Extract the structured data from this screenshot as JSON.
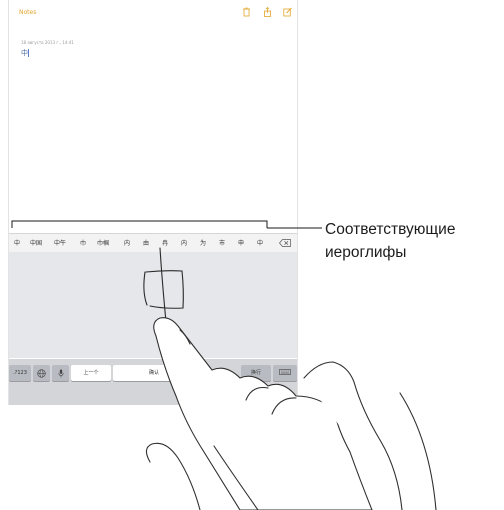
{
  "notes": {
    "title": "Notes",
    "date": "18 августа 2013 г., 14:41",
    "text": "中"
  },
  "candidates": [
    "中",
    "中国",
    "中午",
    "巾",
    "巾帼",
    "内",
    "由",
    "冉",
    "内",
    "为",
    "市",
    "申",
    "中"
  ],
  "keyboard": {
    "numbers_key": ".?123",
    "prev_key": "上一个",
    "confirm_key": "确认",
    "return_key": "换行"
  },
  "handwriting_stroke": "中",
  "callout": {
    "label_line1": "Соответствующие",
    "label_line2": "иероглифы"
  },
  "colors": {
    "notes_accent": "#e1a52b",
    "candidate_bar": "#f3f3f4",
    "handwriting_pad": "#e6e7ea",
    "keyboard_bg": "#d3d5d9"
  }
}
